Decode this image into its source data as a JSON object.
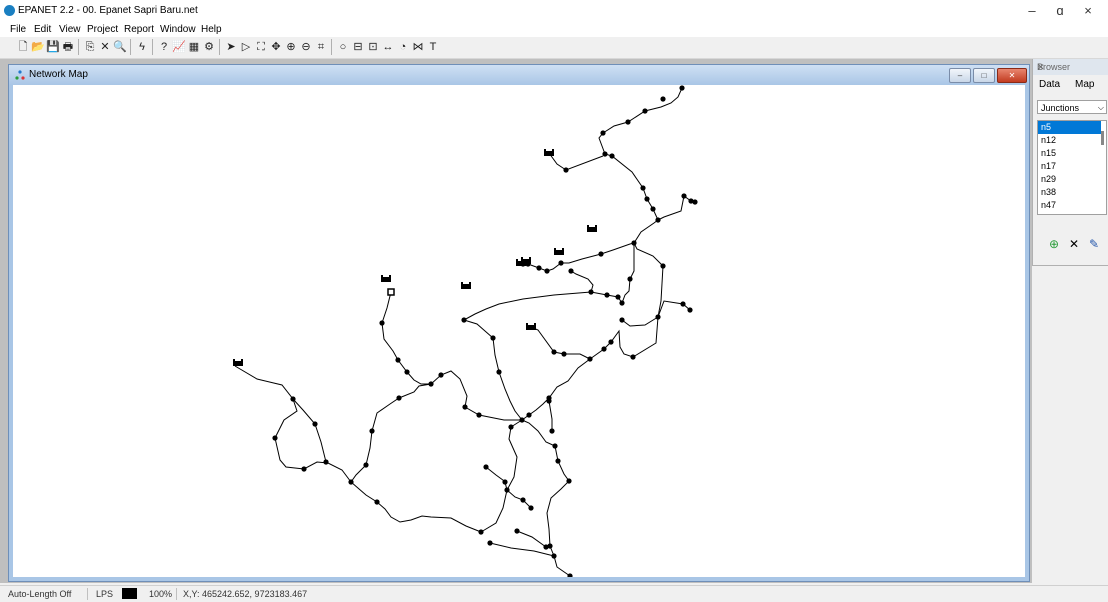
{
  "window": {
    "title": "EPANET 2.2 - 00. Epanet Sapri Baru.net",
    "minimize": "–",
    "restore": "ɑ",
    "close": "×"
  },
  "menu": [
    "File",
    "Edit",
    "View",
    "Project",
    "Report",
    "Window",
    "Help"
  ],
  "toolbar": [
    {
      "icon": "new-file-icon",
      "glyph": "🗋"
    },
    {
      "icon": "open-folder-icon",
      "glyph": "📂"
    },
    {
      "icon": "save-icon",
      "glyph": "💾"
    },
    {
      "icon": "print-icon",
      "glyph": "🖶"
    },
    {
      "sep": true
    },
    {
      "icon": "copy-icon",
      "glyph": "⎘"
    },
    {
      "icon": "delete-icon",
      "glyph": "✕"
    },
    {
      "icon": "find-icon",
      "glyph": "🔍"
    },
    {
      "sep": true
    },
    {
      "icon": "run-icon",
      "glyph": "ϟ"
    },
    {
      "sep": true
    },
    {
      "icon": "query-icon",
      "glyph": "?"
    },
    {
      "icon": "graph-icon",
      "glyph": "📈"
    },
    {
      "icon": "table-icon",
      "glyph": "▦"
    },
    {
      "icon": "options-icon",
      "glyph": "⚙"
    },
    {
      "sep": true
    },
    {
      "icon": "select-object-icon",
      "glyph": "➤"
    },
    {
      "icon": "select-vertex-icon",
      "glyph": "▷"
    },
    {
      "icon": "select-region-icon",
      "glyph": "⛶"
    },
    {
      "icon": "pan-icon",
      "glyph": "✥"
    },
    {
      "icon": "zoom-in-icon",
      "glyph": "⊕"
    },
    {
      "icon": "zoom-out-icon",
      "glyph": "⊖"
    },
    {
      "icon": "full-extent-icon",
      "glyph": "⌗"
    },
    {
      "sep": true
    },
    {
      "icon": "add-junction-icon",
      "glyph": "○"
    },
    {
      "icon": "add-reservoir-icon",
      "glyph": "⊟"
    },
    {
      "icon": "add-tank-icon",
      "glyph": "⊡"
    },
    {
      "icon": "add-pipe-icon",
      "glyph": "↔"
    },
    {
      "icon": "add-pump-icon",
      "glyph": "◔"
    },
    {
      "icon": "add-valve-icon",
      "glyph": "⋈"
    },
    {
      "icon": "add-label-icon",
      "glyph": "T"
    }
  ],
  "map_window": {
    "title": "Network Map",
    "min": "–",
    "max": "□",
    "close": "✕"
  },
  "network": {
    "pipes": [
      [
        [
          681,
          87
        ],
        [
          677,
          96
        ],
        [
          670,
          102
        ],
        [
          660,
          106
        ],
        [
          644,
          110
        ],
        [
          627,
          121
        ],
        [
          613,
          125
        ],
        [
          602,
          132
        ]
      ],
      [
        [
          602,
          132
        ],
        [
          598,
          137
        ],
        [
          604,
          153
        ],
        [
          611,
          155
        ],
        [
          631,
          171
        ],
        [
          642,
          187
        ],
        [
          646,
          198
        ],
        [
          652,
          208
        ],
        [
          657,
          219
        ],
        [
          653,
          222
        ],
        [
          640,
          231
        ],
        [
          633,
          242
        ]
      ],
      [
        [
          548,
          152
        ],
        [
          556,
          163
        ],
        [
          565,
          169
        ],
        [
          602,
          155
        ]
      ],
      [
        [
          683,
          195
        ],
        [
          690,
          200
        ],
        [
          694,
          201
        ]
      ],
      [
        [
          683,
          195
        ],
        [
          680,
          210
        ],
        [
          663,
          216
        ],
        [
          657,
          219
        ]
      ],
      [
        [
          633,
          242
        ],
        [
          629,
          243
        ],
        [
          612,
          249
        ],
        [
          600,
          253
        ],
        [
          581,
          258
        ],
        [
          568,
          262
        ],
        [
          560,
          262
        ]
      ],
      [
        [
          560,
          262
        ],
        [
          552,
          268
        ],
        [
          546,
          270
        ],
        [
          538,
          267
        ],
        [
          527,
          263
        ],
        [
          522,
          263
        ]
      ],
      [
        [
          633,
          242
        ],
        [
          636,
          248
        ],
        [
          652,
          255
        ],
        [
          662,
          265
        ],
        [
          660,
          300
        ],
        [
          657,
          316
        ],
        [
          644,
          324
        ],
        [
          629,
          325
        ],
        [
          621,
          319
        ]
      ],
      [
        [
          633,
          242
        ],
        [
          633,
          270
        ],
        [
          629,
          278
        ],
        [
          628,
          290
        ],
        [
          624,
          294
        ],
        [
          621,
          302
        ],
        [
          617,
          296
        ],
        [
          606,
          294
        ],
        [
          590,
          291
        ]
      ],
      [
        [
          590,
          291
        ],
        [
          553,
          294
        ],
        [
          522,
          298
        ],
        [
          498,
          303
        ],
        [
          485,
          308
        ],
        [
          474,
          313
        ],
        [
          463,
          319
        ]
      ],
      [
        [
          590,
          291
        ],
        [
          592,
          284
        ],
        [
          587,
          278
        ],
        [
          575,
          273
        ],
        [
          570,
          270
        ]
      ],
      [
        [
          657,
          316
        ],
        [
          663,
          300
        ],
        [
          682,
          303
        ],
        [
          689,
          309
        ]
      ],
      [
        [
          657,
          316
        ],
        [
          655,
          342
        ],
        [
          632,
          356
        ],
        [
          623,
          353
        ],
        [
          619,
          346
        ],
        [
          618,
          330
        ],
        [
          610,
          341
        ],
        [
          603,
          348
        ],
        [
          589,
          358
        ]
      ],
      [
        [
          530,
          326
        ],
        [
          537,
          329
        ],
        [
          553,
          351
        ],
        [
          563,
          353
        ],
        [
          579,
          353
        ],
        [
          589,
          358
        ]
      ],
      [
        [
          589,
          358
        ],
        [
          577,
          367
        ],
        [
          567,
          380
        ],
        [
          556,
          386
        ],
        [
          548,
          397
        ],
        [
          542,
          403
        ],
        [
          535,
          409
        ],
        [
          528,
          414
        ],
        [
          521,
          419
        ]
      ],
      [
        [
          463,
          319
        ],
        [
          476,
          323
        ],
        [
          484,
          330
        ],
        [
          492,
          337
        ],
        [
          494,
          354
        ],
        [
          498,
          371
        ],
        [
          504,
          388
        ],
        [
          509,
          400
        ],
        [
          514,
          410
        ],
        [
          521,
          419
        ]
      ],
      [
        [
          390,
          291
        ],
        [
          386,
          307
        ],
        [
          381,
          322
        ],
        [
          383,
          338
        ],
        [
          392,
          350
        ],
        [
          397,
          359
        ],
        [
          406,
          371
        ],
        [
          413,
          379
        ],
        [
          420,
          383
        ],
        [
          430,
          383
        ]
      ],
      [
        [
          430,
          383
        ],
        [
          440,
          374
        ],
        [
          450,
          370
        ],
        [
          459,
          378
        ],
        [
          466,
          395
        ],
        [
          464,
          406
        ],
        [
          478,
          414
        ],
        [
          503,
          419
        ],
        [
          521,
          419
        ]
      ],
      [
        [
          234,
          365
        ],
        [
          256,
          378
        ],
        [
          281,
          384
        ],
        [
          292,
          398
        ],
        [
          296,
          410
        ],
        [
          283,
          419
        ],
        [
          274,
          437
        ],
        [
          279,
          459
        ],
        [
          285,
          466
        ],
        [
          303,
          468
        ],
        [
          316,
          461
        ],
        [
          327,
          462
        ],
        [
          341,
          469
        ],
        [
          350,
          481
        ]
      ],
      [
        [
          292,
          398
        ],
        [
          302,
          409
        ],
        [
          314,
          423
        ],
        [
          320,
          441
        ],
        [
          325,
          461
        ]
      ],
      [
        [
          430,
          383
        ],
        [
          418,
          385
        ],
        [
          413,
          391
        ],
        [
          398,
          397
        ],
        [
          389,
          403
        ],
        [
          376,
          412
        ],
        [
          371,
          430
        ],
        [
          369,
          447
        ],
        [
          365,
          464
        ],
        [
          355,
          474
        ],
        [
          350,
          481
        ]
      ],
      [
        [
          350,
          481
        ],
        [
          365,
          494
        ],
        [
          376,
          501
        ],
        [
          384,
          508
        ],
        [
          390,
          516
        ],
        [
          399,
          521
        ],
        [
          410,
          519
        ],
        [
          421,
          515
        ],
        [
          430,
          516
        ],
        [
          450,
          517
        ],
        [
          465,
          525
        ],
        [
          480,
          531
        ]
      ],
      [
        [
          480,
          531
        ],
        [
          495,
          522
        ],
        [
          502,
          507
        ],
        [
          506,
          489
        ],
        [
          504,
          481
        ]
      ],
      [
        [
          521,
          419
        ],
        [
          528,
          422
        ],
        [
          537,
          430
        ],
        [
          545,
          441
        ],
        [
          554,
          445
        ],
        [
          557,
          460
        ],
        [
          563,
          473
        ],
        [
          568,
          480
        ],
        [
          560,
          488
        ],
        [
          550,
          497
        ],
        [
          546,
          512
        ],
        [
          548,
          528
        ],
        [
          549,
          545
        ],
        [
          553,
          555
        ]
      ],
      [
        [
          521,
          419
        ],
        [
          510,
          426
        ],
        [
          508,
          438
        ],
        [
          516,
          456
        ],
        [
          513,
          476
        ],
        [
          506,
          489
        ],
        [
          514,
          496
        ],
        [
          522,
          499
        ],
        [
          530,
          507
        ]
      ],
      [
        [
          485,
          466
        ],
        [
          495,
          474
        ],
        [
          506,
          482
        ]
      ],
      [
        [
          553,
          555
        ],
        [
          556,
          566
        ],
        [
          569,
          575
        ]
      ],
      [
        [
          489,
          542
        ],
        [
          510,
          547
        ],
        [
          533,
          550
        ],
        [
          553,
          555
        ]
      ],
      [
        [
          516,
          530
        ],
        [
          531,
          536
        ],
        [
          545,
          546
        ]
      ],
      [
        [
          548,
          400
        ],
        [
          551,
          418
        ],
        [
          551,
          430
        ]
      ]
    ],
    "junctions": [
      [
        681,
        87
      ],
      [
        662,
        98
      ],
      [
        644,
        110
      ],
      [
        627,
        121
      ],
      [
        602,
        132
      ],
      [
        604,
        153
      ],
      [
        611,
        155
      ],
      [
        565,
        169
      ],
      [
        642,
        187
      ],
      [
        646,
        198
      ],
      [
        652,
        208
      ],
      [
        657,
        219
      ],
      [
        633,
        242
      ],
      [
        683,
        195
      ],
      [
        690,
        200
      ],
      [
        694,
        201
      ],
      [
        600,
        253
      ],
      [
        560,
        262
      ],
      [
        546,
        270
      ],
      [
        538,
        267
      ],
      [
        527,
        263
      ],
      [
        522,
        263
      ],
      [
        590,
        291
      ],
      [
        570,
        270
      ],
      [
        617,
        296
      ],
      [
        606,
        294
      ],
      [
        621,
        302
      ],
      [
        629,
        278
      ],
      [
        662,
        265
      ],
      [
        657,
        316
      ],
      [
        621,
        319
      ],
      [
        682,
        303
      ],
      [
        689,
        309
      ],
      [
        632,
        356
      ],
      [
        610,
        341
      ],
      [
        603,
        348
      ],
      [
        589,
        358
      ],
      [
        563,
        353
      ],
      [
        553,
        351
      ],
      [
        463,
        319
      ],
      [
        492,
        337
      ],
      [
        498,
        371
      ],
      [
        521,
        419
      ],
      [
        528,
        414
      ],
      [
        381,
        322
      ],
      [
        397,
        359
      ],
      [
        406,
        371
      ],
      [
        430,
        383
      ],
      [
        440,
        374
      ],
      [
        464,
        406
      ],
      [
        478,
        414
      ],
      [
        292,
        398
      ],
      [
        274,
        437
      ],
      [
        303,
        468
      ],
      [
        325,
        461
      ],
      [
        314,
        423
      ],
      [
        350,
        481
      ],
      [
        365,
        464
      ],
      [
        371,
        430
      ],
      [
        398,
        397
      ],
      [
        376,
        501
      ],
      [
        480,
        531
      ],
      [
        506,
        489
      ],
      [
        504,
        481
      ],
      [
        485,
        466
      ],
      [
        554,
        445
      ],
      [
        557,
        460
      ],
      [
        551,
        430
      ],
      [
        548,
        397
      ],
      [
        549,
        545
      ],
      [
        553,
        555
      ],
      [
        569,
        575
      ],
      [
        489,
        542
      ],
      [
        516,
        530
      ],
      [
        545,
        546
      ],
      [
        522,
        499
      ],
      [
        510,
        426
      ],
      [
        530,
        507
      ],
      [
        548,
        400
      ],
      [
        568,
        480
      ]
    ],
    "reservoirs": [
      [
        548,
        152
      ],
      [
        385,
        278
      ],
      [
        465,
        285
      ],
      [
        237,
        362
      ],
      [
        530,
        326
      ],
      [
        591,
        228
      ],
      [
        558,
        251
      ],
      [
        520,
        262
      ],
      [
        525,
        260
      ]
    ],
    "tank": [
      390,
      291
    ]
  },
  "browser": {
    "title": "Browser",
    "tabs": [
      "Data",
      "Map"
    ],
    "category": "Junctions",
    "items": [
      "n5",
      "n12",
      "n15",
      "n17",
      "n29",
      "n38",
      "n47"
    ],
    "selected": "n5"
  },
  "status": {
    "auto_length": "Auto-Length Off",
    "units": "LPS",
    "zoom": "100%",
    "coords": "X,Y: 465242.652, 9723183.467"
  }
}
